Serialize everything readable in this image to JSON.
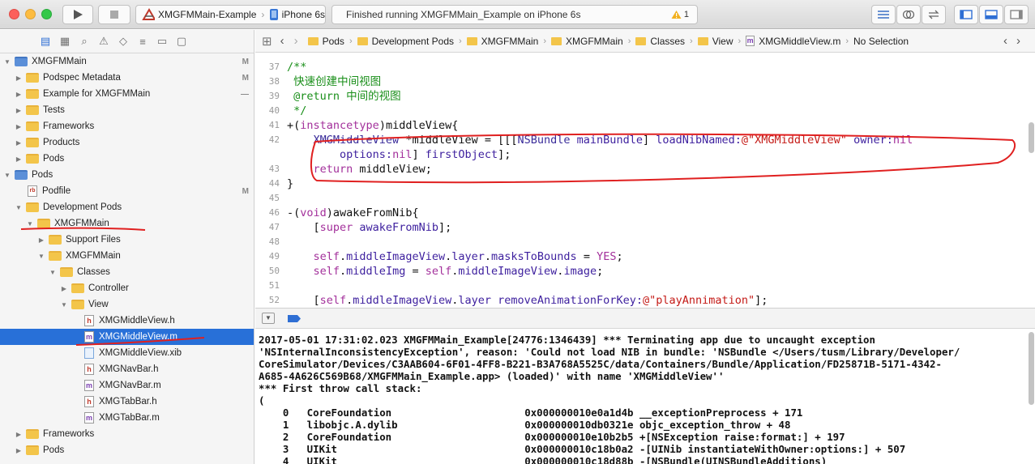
{
  "toolbar": {
    "scheme": "XMGFMMain-Example",
    "device": "iPhone 6s",
    "status": "Finished running XMGFMMain_Example on iPhone 6s",
    "warning_count": "1"
  },
  "navigator": {
    "rows": [
      {
        "label": "XMGFMMain",
        "depth": 0,
        "open": true,
        "kind": "project",
        "badge": "M"
      },
      {
        "label": "Podspec Metadata",
        "depth": 1,
        "open": false,
        "kind": "folder",
        "badge": "M"
      },
      {
        "label": "Example for XMGFMMain",
        "depth": 1,
        "open": false,
        "kind": "folder",
        "badge": "—"
      },
      {
        "label": "Tests",
        "depth": 1,
        "open": false,
        "kind": "folder",
        "badge": ""
      },
      {
        "label": "Frameworks",
        "depth": 1,
        "open": false,
        "kind": "folder",
        "badge": ""
      },
      {
        "label": "Products",
        "depth": 1,
        "open": false,
        "kind": "folder",
        "badge": ""
      },
      {
        "label": "Pods",
        "depth": 1,
        "open": false,
        "kind": "folder",
        "badge": ""
      },
      {
        "label": "Pods",
        "depth": 0,
        "open": true,
        "kind": "project",
        "badge": ""
      },
      {
        "label": "Podfile",
        "depth": 1,
        "open": null,
        "kind": "rb",
        "badge": "M"
      },
      {
        "label": "Development Pods",
        "depth": 1,
        "open": true,
        "kind": "folder",
        "badge": ""
      },
      {
        "label": "XMGFMMain",
        "depth": 2,
        "open": true,
        "kind": "folder",
        "badge": ""
      },
      {
        "label": "Support Files",
        "depth": 3,
        "open": false,
        "kind": "folder",
        "badge": ""
      },
      {
        "label": "XMGFMMain",
        "depth": 3,
        "open": true,
        "kind": "folder",
        "badge": ""
      },
      {
        "label": "Classes",
        "depth": 4,
        "open": true,
        "kind": "folder",
        "badge": ""
      },
      {
        "label": "Controller",
        "depth": 5,
        "open": false,
        "kind": "folder",
        "badge": ""
      },
      {
        "label": "View",
        "depth": 5,
        "open": true,
        "kind": "folder",
        "badge": ""
      },
      {
        "label": "XMGMiddleView.h",
        "depth": 6,
        "open": null,
        "kind": "h",
        "badge": ""
      },
      {
        "label": "XMGMiddleView.m",
        "depth": 6,
        "open": null,
        "kind": "m",
        "badge": "",
        "selected": true
      },
      {
        "label": "XMGMiddleView.xib",
        "depth": 6,
        "open": null,
        "kind": "xib",
        "badge": ""
      },
      {
        "label": "XMGNavBar.h",
        "depth": 6,
        "open": null,
        "kind": "h",
        "badge": ""
      },
      {
        "label": "XMGNavBar.m",
        "depth": 6,
        "open": null,
        "kind": "m",
        "badge": ""
      },
      {
        "label": "XMGTabBar.h",
        "depth": 6,
        "open": null,
        "kind": "h",
        "badge": ""
      },
      {
        "label": "XMGTabBar.m",
        "depth": 6,
        "open": null,
        "kind": "m",
        "badge": ""
      },
      {
        "label": "Frameworks",
        "depth": 1,
        "open": false,
        "kind": "folder",
        "badge": ""
      },
      {
        "label": "Pods",
        "depth": 1,
        "open": false,
        "kind": "folder",
        "badge": ""
      }
    ]
  },
  "jumpbar": {
    "crumbs": [
      "Pods",
      "Development Pods",
      "XMGFMMain",
      "XMGFMMain",
      "Classes",
      "View"
    ],
    "file": "XMGMiddleView.m",
    "selection": "No Selection"
  },
  "editor": {
    "lines": [
      {
        "n": "37",
        "tokens": [
          [
            "cm",
            "/**"
          ]
        ]
      },
      {
        "n": "38",
        "tokens": [
          [
            "cm",
            " 快速创建中间视图"
          ]
        ]
      },
      {
        "n": "39",
        "tokens": [
          [
            "cm",
            " @return 中间的视图"
          ]
        ]
      },
      {
        "n": "40",
        "tokens": [
          [
            "cm",
            " */"
          ]
        ]
      },
      {
        "n": "41",
        "tokens": [
          [
            "",
            "+("
          ],
          [
            "kw",
            "instancetype"
          ],
          [
            "",
            ")middleView{"
          ]
        ]
      },
      {
        "n": "42",
        "tokens": [
          [
            "",
            "    "
          ],
          [
            "cls",
            "XMGMiddleView"
          ],
          [
            "",
            " *middleView = [[["
          ],
          [
            "cls",
            "NSBundle"
          ],
          [
            "",
            " "
          ],
          [
            "prop",
            "mainBundle"
          ],
          [
            "",
            "] "
          ],
          [
            "prop",
            "loadNibNamed:"
          ],
          [
            "str",
            "@\"XMGMiddleView\""
          ],
          [
            "",
            " "
          ],
          [
            "prop",
            "owner:"
          ],
          [
            "kw",
            "nil"
          ]
        ]
      },
      {
        "n": "",
        "tokens": [
          [
            "",
            "        "
          ],
          [
            "prop",
            "options:"
          ],
          [
            "kw",
            "nil"
          ],
          [
            "",
            "] "
          ],
          [
            "prop",
            "firstObject"
          ],
          [
            "",
            "];"
          ]
        ]
      },
      {
        "n": "43",
        "tokens": [
          [
            "",
            "    "
          ],
          [
            "kw",
            "return"
          ],
          [
            "",
            " middleView;"
          ]
        ]
      },
      {
        "n": "44",
        "tokens": [
          [
            "",
            "}"
          ]
        ]
      },
      {
        "n": "45",
        "tokens": [
          [
            "",
            ""
          ]
        ]
      },
      {
        "n": "46",
        "tokens": [
          [
            "",
            "-("
          ],
          [
            "kw",
            "void"
          ],
          [
            "",
            ")awakeFromNib{"
          ]
        ]
      },
      {
        "n": "47",
        "tokens": [
          [
            "",
            "    ["
          ],
          [
            "kw",
            "super"
          ],
          [
            "",
            " "
          ],
          [
            "prop",
            "awakeFromNib"
          ],
          [
            "",
            "];"
          ]
        ]
      },
      {
        "n": "48",
        "tokens": [
          [
            "",
            ""
          ]
        ]
      },
      {
        "n": "49",
        "tokens": [
          [
            "",
            "    "
          ],
          [
            "kw",
            "self"
          ],
          [
            "",
            "."
          ],
          [
            "prop",
            "middleImageView"
          ],
          [
            "",
            "."
          ],
          [
            "prop",
            "layer"
          ],
          [
            "",
            "."
          ],
          [
            "prop",
            "masksToBounds"
          ],
          [
            "",
            " = "
          ],
          [
            "kw",
            "YES"
          ],
          [
            "",
            ";"
          ]
        ]
      },
      {
        "n": "50",
        "tokens": [
          [
            "",
            "    "
          ],
          [
            "kw",
            "self"
          ],
          [
            "",
            "."
          ],
          [
            "prop",
            "middleImg"
          ],
          [
            "",
            " = "
          ],
          [
            "kw",
            "self"
          ],
          [
            "",
            "."
          ],
          [
            "prop",
            "middleImageView"
          ],
          [
            "",
            "."
          ],
          [
            "prop",
            "image"
          ],
          [
            "",
            ";"
          ]
        ]
      },
      {
        "n": "51",
        "tokens": [
          [
            "",
            ""
          ]
        ]
      },
      {
        "n": "52",
        "tokens": [
          [
            "",
            "    ["
          ],
          [
            "kw",
            "self"
          ],
          [
            "",
            "."
          ],
          [
            "prop",
            "middleImageView"
          ],
          [
            "",
            "."
          ],
          [
            "prop",
            "layer"
          ],
          [
            "",
            " "
          ],
          [
            "prop",
            "removeAnimationForKey:"
          ],
          [
            "str",
            "@\"playAnnimation\""
          ],
          [
            "",
            "];"
          ]
        ]
      }
    ]
  },
  "console": {
    "lines": [
      "2017-05-01 17:31:02.023 XMGFMMain_Example[24776:1346439] *** Terminating app due to uncaught exception",
      "'NSInternalInconsistencyException', reason: 'Could not load NIB in bundle: 'NSBundle </Users/tusm/Library/Developer/",
      "CoreSimulator/Devices/C3AAB604-6F01-4FF8-B221-B3A768A5525C/data/Containers/Bundle/Application/FD25871B-5171-4342-",
      "A685-4A626C569B68/XMGFMMain_Example.app> (loaded)' with name 'XMGMiddleView''",
      "*** First throw call stack:",
      "(",
      "    0   CoreFoundation                      0x000000010e0a1d4b __exceptionPreprocess + 171",
      "    1   libobjc.A.dylib                     0x000000010db0321e objc_exception_throw + 48",
      "    2   CoreFoundation                      0x000000010e10b2b5 +[NSException raise:format:] + 197",
      "    3   UIKit                               0x000000010c18b0a2 -[UINib instantiateWithOwner:options:] + 507",
      "    4   UIKit                               0x000000010c18d88b -[NSBundle(UINSBundleAdditions)"
    ]
  },
  "colors": {
    "selection": "#2870d8",
    "annotation": "#e02020",
    "comment": "#1a8f1a",
    "keyword": "#a3309b"
  }
}
